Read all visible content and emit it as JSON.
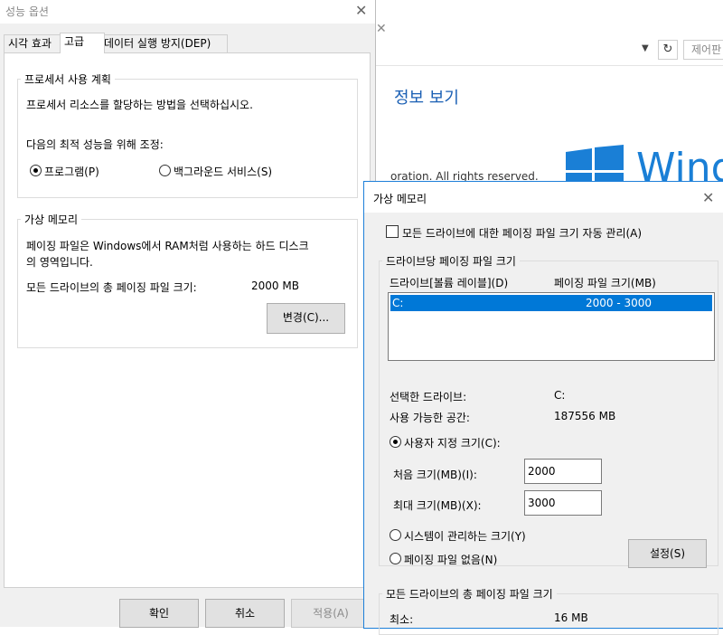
{
  "bg_window": {
    "search_placeholder": "제어판",
    "info_title": "정보 보기",
    "copyright": "oration. All rights reserved.",
    "windows_text": "Wind",
    "accent": "#1a7fd6"
  },
  "perf_dialog": {
    "title": "성능 옵션",
    "tabs": [
      "시각 효과",
      "고급",
      "데이터 실행 방지(DEP)"
    ],
    "active_tab": "고급",
    "processor": {
      "legend": "프로세서 사용 계획",
      "description": "프로세서 리소스를 할당하는 방법을 선택하십시오.",
      "adjust_label": "다음의 최적 성능을 위해 조정:",
      "option_programs": "프로그램(P)",
      "option_background": "백그라운드 서비스(S)",
      "selected": "프로그램(P)"
    },
    "virtual_memory": {
      "legend": "가상 메모리",
      "description_line1": "페이징 파일은 Windows에서 RAM처럼 사용하는 하드 디스크",
      "description_line2": "의 영역입니다.",
      "total_label": "모든 드라이브의 총 페이징 파일 크기:",
      "total_value": "2000 MB",
      "change_button": "변경(C)..."
    },
    "buttons": {
      "ok": "확인",
      "cancel": "취소",
      "apply": "적용(A)"
    }
  },
  "vm_dialog": {
    "title": "가상 메모리",
    "auto_manage_label": "모든 드라이브에 대한 페이징 파일 크기 자동 관리(A)",
    "auto_manage_checked": false,
    "per_drive_legend": "드라이브당 페이징 파일 크기",
    "col_drive": "드라이브[볼륨 레이블](D)",
    "col_size": "페이징 파일 크기(MB)",
    "drives": [
      {
        "drive": "C:",
        "size": "2000 - 3000"
      }
    ],
    "selected_drive_label": "선택한 드라이브:",
    "selected_drive_value": "C:",
    "free_space_label": "사용 가능한 공간:",
    "free_space_value": "187556 MB",
    "custom_size_label": "사용자 지정 크기(C):",
    "initial_label": "처음 크기(MB)(I):",
    "initial_value": "2000",
    "max_label": "최대 크기(MB)(X):",
    "max_value": "3000",
    "system_managed_label": "시스템이 관리하는 크기(Y)",
    "no_paging_label": "페이징 파일 없음(N)",
    "set_button": "설정(S)",
    "total_legend": "모든 드라이브의 총 페이징 파일 크기",
    "min_label": "최소:",
    "min_value": "16 MB",
    "selected_option": "사용자 지정 크기(C):",
    "selection_color": "#0078d7",
    "frame_color": "#1d7fd9"
  }
}
